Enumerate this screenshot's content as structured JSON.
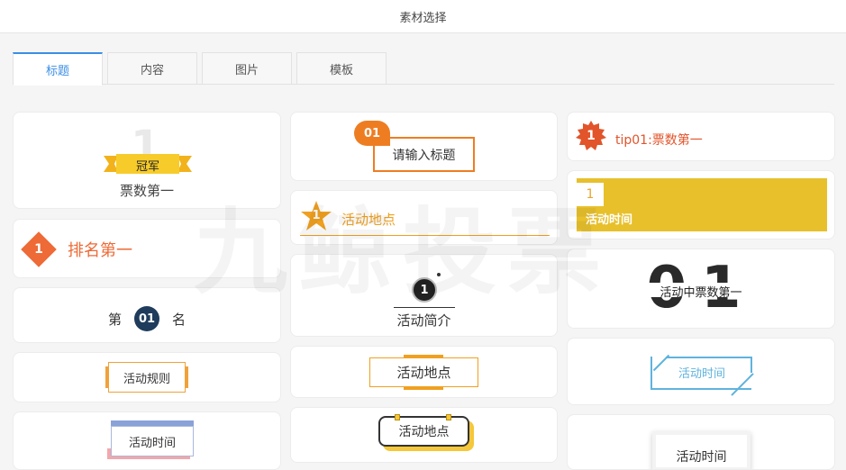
{
  "header": {
    "title": "素材选择"
  },
  "tabs": [
    {
      "label": "标题",
      "active": true
    },
    {
      "label": "内容",
      "active": false
    },
    {
      "label": "图片",
      "active": false
    },
    {
      "label": "模板",
      "active": false
    }
  ],
  "watermark": "九鲸投票",
  "cards": {
    "champion": {
      "big_number": "1",
      "ribbon_text": "冠军",
      "subtitle": "票数第一"
    },
    "rank": {
      "number": "1",
      "text": "排名第一"
    },
    "place": {
      "prefix": "第",
      "number": "01",
      "suffix": "名"
    },
    "rules": {
      "text": "活动规则"
    },
    "time_stack": {
      "text": "活动时间"
    },
    "title_input": {
      "badge": "01",
      "text": "请输入标题"
    },
    "location_star": {
      "number": "1",
      "text": "活动地点"
    },
    "intro": {
      "number": "1",
      "text": "活动简介"
    },
    "location_dash": {
      "text": "活动地点"
    },
    "location_round": {
      "text": "活动地点"
    },
    "tip": {
      "number": "1",
      "text": "tip01:票数第一"
    },
    "time_yellow": {
      "number": "1",
      "text": "活动时间"
    },
    "votes_big": {
      "big_number": "01",
      "text": "活动中票数第一"
    },
    "time_slash": {
      "text": "活动时间"
    },
    "time_frame": {
      "text": "活动时间"
    }
  },
  "colors": {
    "accent_blue": "#3a8ee6",
    "orange": "#ee6a36",
    "amber": "#f0a020",
    "navy": "#1f3c5c",
    "yellow": "#e7c02c",
    "sky": "#5fb3dd"
  }
}
